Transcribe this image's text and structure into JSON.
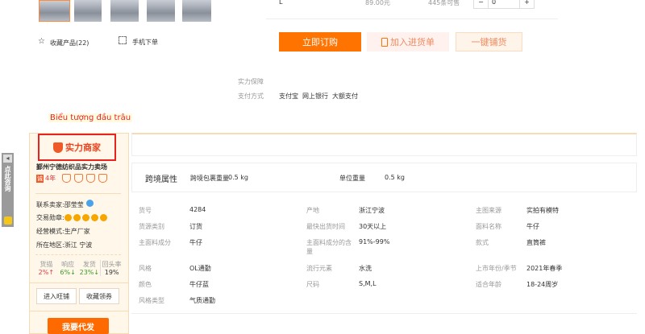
{
  "gallery": {
    "thumbnails": 5
  },
  "sku_row": {
    "size": "L",
    "price": "89.00元",
    "stock": "445条可售",
    "quantity": "0",
    "minus": "−",
    "plus": "+"
  },
  "actions": {
    "favorite": "收藏产品(22)",
    "mobile_order": "手机下单",
    "buy_now": "立即订购",
    "add_cart": "加入进货单",
    "one_click": "一键铺货"
  },
  "service": {
    "guarantee_label": "实力保障",
    "payment_label": "支付方式",
    "payments": [
      "支付宝",
      "网上银行",
      "大额支付"
    ]
  },
  "annotation": "Biểu tượng đầu trâu",
  "side_tab": {
    "text": "点此咨询",
    "arrow": "◂"
  },
  "seller": {
    "badge": "实力商家",
    "name": "鄞州宁德纺织品实力卖场",
    "years": "4年",
    "years_icon": "诚",
    "contact_label": "联系卖家:",
    "contact": "邵莹莹",
    "medal_label": "交易勋章:",
    "mode_label": "经营模式:",
    "mode": "生产厂家",
    "region_label": "所在地区:",
    "region": "浙江 宁波",
    "stats": [
      {
        "label": "货描",
        "value": "2%↑",
        "color": "#e4393c"
      },
      {
        "label": "响应",
        "value": "6%↓",
        "color": "#3a9d23"
      },
      {
        "label": "发货",
        "value": "23%↓",
        "color": "#3a9d23"
      },
      {
        "label": "回头率",
        "value": "19%",
        "color": "#333"
      }
    ],
    "enter_shop": "进入旺铺",
    "collect_coupon": "收藏领券",
    "dropship": "我要代发"
  },
  "cross_border": {
    "title": "跨境属性",
    "pkg_label": "跨境包裹重量",
    "pkg_value": "0.5 kg",
    "unit_label": "单位重量",
    "unit_value": "0.5 kg"
  },
  "attributes": [
    [
      {
        "l": "货号",
        "v": "4284"
      },
      {
        "l": "产地",
        "v": "浙江宁波"
      },
      {
        "l": "主图来源",
        "v": "实拍有模特"
      }
    ],
    [
      {
        "l": "货源类别",
        "v": "订货"
      },
      {
        "l": "最快出货时间",
        "v": "30天以上"
      },
      {
        "l": "面料名称",
        "v": "牛仔"
      }
    ],
    [
      {
        "l": "主面料成分",
        "v": "牛仔"
      },
      {
        "l": "主面料成分的含量",
        "v": "91%-99%"
      },
      {
        "l": "款式",
        "v": "直筒裤"
      }
    ],
    [
      {
        "l": "风格",
        "v": "OL通勤"
      },
      {
        "l": "流行元素",
        "v": "水洗"
      },
      {
        "l": "上市年份/季节",
        "v": "2021年春季"
      }
    ],
    [
      {
        "l": "颜色",
        "v": "牛仔蓝"
      },
      {
        "l": "尺码",
        "v": "S,M,L"
      },
      {
        "l": "适合年龄",
        "v": "18-24周岁"
      }
    ],
    [
      {
        "l": "风格类型",
        "v": "气质通勤"
      }
    ]
  ],
  "colors": {
    "accent": "#ff7300",
    "highlight": "#e4393c"
  }
}
